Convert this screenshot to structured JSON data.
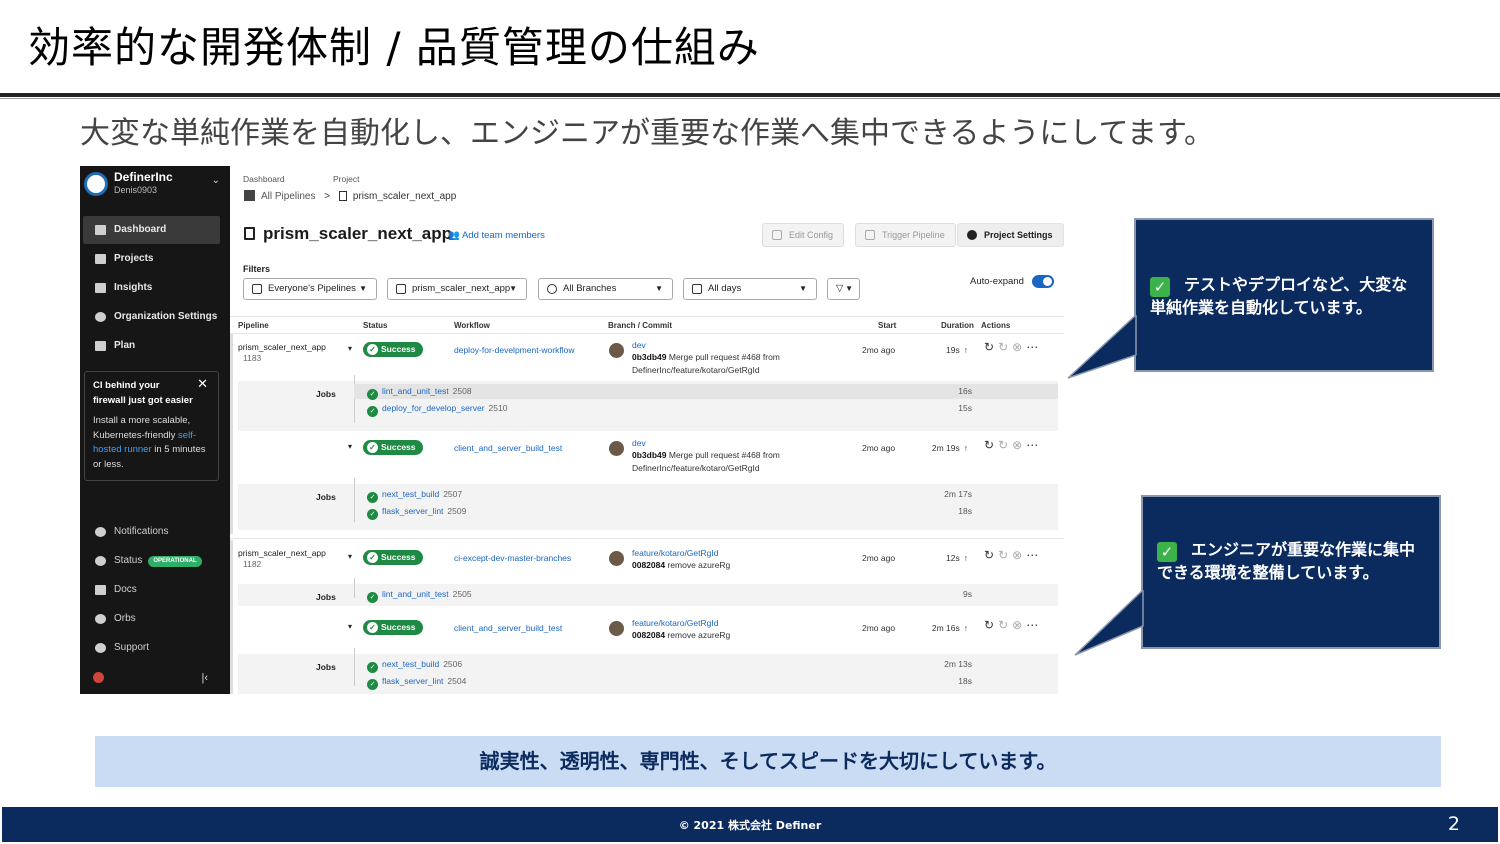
{
  "slide": {
    "title": "効率的な開発体制 / 品質管理の仕組み",
    "subtitle": "大変な単純作業を自動化し、エンジニアが重要な作業へ集中できるようにしてます。",
    "banner": "誠実性、透明性、専門性、そしてスピードを大切にしています。",
    "footer": "© 2021 株式会社 Definer",
    "page_number": "2",
    "callouts": [
      {
        "check": "✓",
        "text": "テストやデプロイなど、大変な単純作業を自動化しています。"
      },
      {
        "check": "✓",
        "text": "エンジニアが重要な作業に集中できる環境を整備しています。"
      }
    ],
    "colors": {
      "navy": "#0b2a5e",
      "banner_bg": "#c9dcf3",
      "success": "#1e8a44",
      "link": "#1a66c4",
      "sidebar": "#161616"
    }
  },
  "app": {
    "org": {
      "name": "DefinerInc",
      "user": "Denis0903"
    },
    "nav": [
      {
        "label": "Dashboard",
        "icon": "dashboard-icon",
        "active": true
      },
      {
        "label": "Projects",
        "icon": "projects-icon"
      },
      {
        "label": "Insights",
        "icon": "insights-icon"
      },
      {
        "label": "Organization Settings",
        "icon": "gear-icon"
      },
      {
        "label": "Plan",
        "icon": "plan-icon"
      }
    ],
    "promo": {
      "title": "CI behind your firewall just got easier",
      "body_1": "Install a more scalable, Kubernetes-friendly ",
      "link": "self-hosted runner",
      "body_2": " in 5 minutes or less."
    },
    "nav_bottom": [
      {
        "label": "Notifications",
        "icon": "bell-icon"
      },
      {
        "label": "Status",
        "icon": "status-icon",
        "badge": "OPERATIONAL"
      },
      {
        "label": "Docs",
        "icon": "docs-icon"
      },
      {
        "label": "Orbs",
        "icon": "orbs-icon"
      },
      {
        "label": "Support",
        "icon": "help-icon"
      }
    ],
    "breadcrumb": {
      "label_1": "Dashboard",
      "label_2": "Project",
      "item_1": "All Pipelines",
      "sep": ">",
      "item_2": "prism_scaler_next_app"
    },
    "project_title": "prism_scaler_next_app",
    "add_team": "Add team members",
    "buttons": {
      "edit": "Edit Config",
      "trigger": "Trigger Pipeline",
      "settings": "Project Settings"
    },
    "filters": {
      "label": "Filters",
      "pipelines": "Everyone's Pipelines",
      "project": "prism_scaler_next_app",
      "branches": "All Branches",
      "days": "All days",
      "auto_expand": "Auto-expand"
    },
    "columns": {
      "pipeline": "Pipeline",
      "status": "Status",
      "workflow": "Workflow",
      "branch": "Branch / Commit",
      "start": "Start",
      "duration": "Duration",
      "actions": "Actions"
    },
    "jobs_label": "Jobs",
    "pipelines": [
      {
        "name": "prism_scaler_next_app",
        "number": "1183",
        "workflows": [
          {
            "status": "Success",
            "name": "deploy-for-develpment-workflow",
            "branch": "dev",
            "sha": "0b3db49",
            "msg": " Merge pull request #468 from",
            "msg2": "DefinerInc/feature/kotaro/GetRgId",
            "start": "2mo ago",
            "duration": "19s",
            "jobs": [
              {
                "name": "lint_and_unit_test",
                "id": "2508",
                "dur": "16s"
              },
              {
                "name": "deploy_for_develop_server",
                "id": "2510",
                "dur": "15s"
              }
            ]
          },
          {
            "status": "Success",
            "name": "client_and_server_build_test",
            "branch": "dev",
            "sha": "0b3db49",
            "msg": " Merge pull request #468 from",
            "msg2": "DefinerInc/feature/kotaro/GetRgId",
            "start": "2mo ago",
            "duration": "2m 19s",
            "jobs": [
              {
                "name": "next_test_build",
                "id": "2507",
                "dur": "2m 17s"
              },
              {
                "name": "flask_server_lint",
                "id": "2509",
                "dur": "18s"
              }
            ]
          }
        ]
      },
      {
        "name": "prism_scaler_next_app",
        "number": "1182",
        "workflows": [
          {
            "status": "Success",
            "name": "ci-except-dev-master-branches",
            "branch": "feature/kotaro/GetRgId",
            "sha": "0082084",
            "msg": " remove azureRg",
            "start": "2mo ago",
            "duration": "12s",
            "jobs": [
              {
                "name": "lint_and_unit_test",
                "id": "2505",
                "dur": "9s"
              }
            ]
          },
          {
            "status": "Success",
            "name": "client_and_server_build_test",
            "branch": "feature/kotaro/GetRgId",
            "sha": "0082084",
            "msg": " remove azureRg",
            "start": "2mo ago",
            "duration": "2m 16s",
            "jobs": [
              {
                "name": "next_test_build",
                "id": "2506",
                "dur": "2m 13s"
              },
              {
                "name": "flask_server_lint",
                "id": "2504",
                "dur": "18s"
              }
            ]
          }
        ]
      }
    ]
  }
}
